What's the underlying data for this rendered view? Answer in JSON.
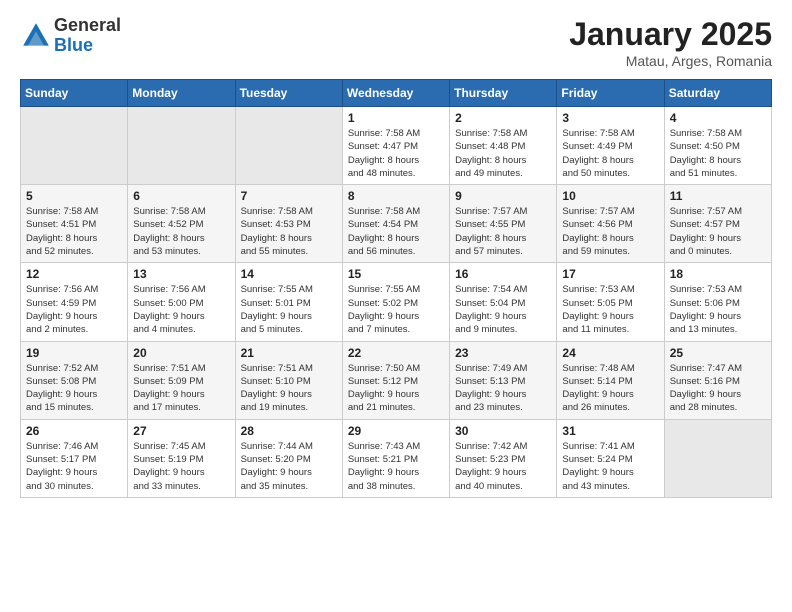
{
  "logo": {
    "general": "General",
    "blue": "Blue"
  },
  "title": "January 2025",
  "location": "Matau, Arges, Romania",
  "weekdays": [
    "Sunday",
    "Monday",
    "Tuesday",
    "Wednesday",
    "Thursday",
    "Friday",
    "Saturday"
  ],
  "weeks": [
    [
      {
        "day": "",
        "info": ""
      },
      {
        "day": "",
        "info": ""
      },
      {
        "day": "",
        "info": ""
      },
      {
        "day": "1",
        "info": "Sunrise: 7:58 AM\nSunset: 4:47 PM\nDaylight: 8 hours\nand 48 minutes."
      },
      {
        "day": "2",
        "info": "Sunrise: 7:58 AM\nSunset: 4:48 PM\nDaylight: 8 hours\nand 49 minutes."
      },
      {
        "day": "3",
        "info": "Sunrise: 7:58 AM\nSunset: 4:49 PM\nDaylight: 8 hours\nand 50 minutes."
      },
      {
        "day": "4",
        "info": "Sunrise: 7:58 AM\nSunset: 4:50 PM\nDaylight: 8 hours\nand 51 minutes."
      }
    ],
    [
      {
        "day": "5",
        "info": "Sunrise: 7:58 AM\nSunset: 4:51 PM\nDaylight: 8 hours\nand 52 minutes."
      },
      {
        "day": "6",
        "info": "Sunrise: 7:58 AM\nSunset: 4:52 PM\nDaylight: 8 hours\nand 53 minutes."
      },
      {
        "day": "7",
        "info": "Sunrise: 7:58 AM\nSunset: 4:53 PM\nDaylight: 8 hours\nand 55 minutes."
      },
      {
        "day": "8",
        "info": "Sunrise: 7:58 AM\nSunset: 4:54 PM\nDaylight: 8 hours\nand 56 minutes."
      },
      {
        "day": "9",
        "info": "Sunrise: 7:57 AM\nSunset: 4:55 PM\nDaylight: 8 hours\nand 57 minutes."
      },
      {
        "day": "10",
        "info": "Sunrise: 7:57 AM\nSunset: 4:56 PM\nDaylight: 8 hours\nand 59 minutes."
      },
      {
        "day": "11",
        "info": "Sunrise: 7:57 AM\nSunset: 4:57 PM\nDaylight: 9 hours\nand 0 minutes."
      }
    ],
    [
      {
        "day": "12",
        "info": "Sunrise: 7:56 AM\nSunset: 4:59 PM\nDaylight: 9 hours\nand 2 minutes."
      },
      {
        "day": "13",
        "info": "Sunrise: 7:56 AM\nSunset: 5:00 PM\nDaylight: 9 hours\nand 4 minutes."
      },
      {
        "day": "14",
        "info": "Sunrise: 7:55 AM\nSunset: 5:01 PM\nDaylight: 9 hours\nand 5 minutes."
      },
      {
        "day": "15",
        "info": "Sunrise: 7:55 AM\nSunset: 5:02 PM\nDaylight: 9 hours\nand 7 minutes."
      },
      {
        "day": "16",
        "info": "Sunrise: 7:54 AM\nSunset: 5:04 PM\nDaylight: 9 hours\nand 9 minutes."
      },
      {
        "day": "17",
        "info": "Sunrise: 7:53 AM\nSunset: 5:05 PM\nDaylight: 9 hours\nand 11 minutes."
      },
      {
        "day": "18",
        "info": "Sunrise: 7:53 AM\nSunset: 5:06 PM\nDaylight: 9 hours\nand 13 minutes."
      }
    ],
    [
      {
        "day": "19",
        "info": "Sunrise: 7:52 AM\nSunset: 5:08 PM\nDaylight: 9 hours\nand 15 minutes."
      },
      {
        "day": "20",
        "info": "Sunrise: 7:51 AM\nSunset: 5:09 PM\nDaylight: 9 hours\nand 17 minutes."
      },
      {
        "day": "21",
        "info": "Sunrise: 7:51 AM\nSunset: 5:10 PM\nDaylight: 9 hours\nand 19 minutes."
      },
      {
        "day": "22",
        "info": "Sunrise: 7:50 AM\nSunset: 5:12 PM\nDaylight: 9 hours\nand 21 minutes."
      },
      {
        "day": "23",
        "info": "Sunrise: 7:49 AM\nSunset: 5:13 PM\nDaylight: 9 hours\nand 23 minutes."
      },
      {
        "day": "24",
        "info": "Sunrise: 7:48 AM\nSunset: 5:14 PM\nDaylight: 9 hours\nand 26 minutes."
      },
      {
        "day": "25",
        "info": "Sunrise: 7:47 AM\nSunset: 5:16 PM\nDaylight: 9 hours\nand 28 minutes."
      }
    ],
    [
      {
        "day": "26",
        "info": "Sunrise: 7:46 AM\nSunset: 5:17 PM\nDaylight: 9 hours\nand 30 minutes."
      },
      {
        "day": "27",
        "info": "Sunrise: 7:45 AM\nSunset: 5:19 PM\nDaylight: 9 hours\nand 33 minutes."
      },
      {
        "day": "28",
        "info": "Sunrise: 7:44 AM\nSunset: 5:20 PM\nDaylight: 9 hours\nand 35 minutes."
      },
      {
        "day": "29",
        "info": "Sunrise: 7:43 AM\nSunset: 5:21 PM\nDaylight: 9 hours\nand 38 minutes."
      },
      {
        "day": "30",
        "info": "Sunrise: 7:42 AM\nSunset: 5:23 PM\nDaylight: 9 hours\nand 40 minutes."
      },
      {
        "day": "31",
        "info": "Sunrise: 7:41 AM\nSunset: 5:24 PM\nDaylight: 9 hours\nand 43 minutes."
      },
      {
        "day": "",
        "info": ""
      }
    ]
  ]
}
